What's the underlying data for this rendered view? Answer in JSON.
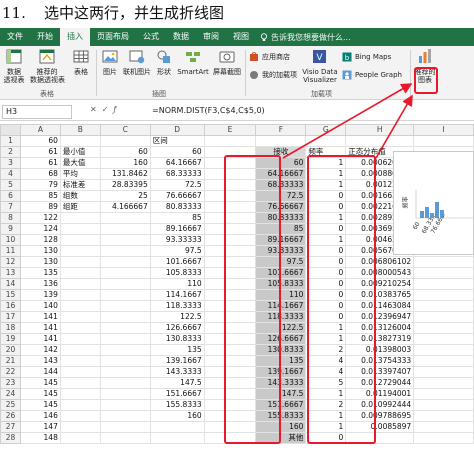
{
  "heading": {
    "num": "11.",
    "text": "选中这两行，并生成折线图"
  },
  "ribbon": {
    "tabs": [
      "文件",
      "开始",
      "插入",
      "页面布局",
      "公式",
      "数据",
      "审阅",
      "视图"
    ],
    "active_tab": "插入",
    "tell_me": "告诉我您想要做什么...",
    "buttons": {
      "pivot": "数据\n透视表",
      "rec_pivot": "推荐的\n数据透视表",
      "table": "表格",
      "picture": "图片",
      "online_pic": "联机图片",
      "shapes": "形状",
      "smartart": "SmartArt",
      "screenshot": "屏幕截图",
      "store": "应用商店",
      "my_addins": "我的加载项",
      "visio": "Visio Data\nVisualizer",
      "bing": "Bing Maps",
      "people": "People Graph",
      "rec_charts": "推荐的\n图表"
    },
    "groups": {
      "tables": "表格",
      "illustrations": "插图",
      "addins": "加载项"
    }
  },
  "formula_bar": {
    "name_box": "H3",
    "formula": "=NORM.DIST(F3,C$4,C$5,0)"
  },
  "grid": {
    "columns": [
      "A",
      "B",
      "C",
      "D",
      "E",
      "F",
      "G",
      "H",
      "I"
    ],
    "rows": [
      {
        "n": "1",
        "A": "60",
        "B": "",
        "C": "",
        "D": "区间",
        "E": "",
        "F": "",
        "G": "",
        "H": ""
      },
      {
        "n": "2",
        "A": "61",
        "B": "最小值",
        "C": "60",
        "D": "60",
        "E": "",
        "F": "接收",
        "G": "频率",
        "H": "正态分布值"
      },
      {
        "n": "3",
        "A": "61",
        "B": "最大值",
        "C": "160",
        "D": "64.16667",
        "E": "",
        "F": "60",
        "G": "1",
        "H": "0.000620597"
      },
      {
        "n": "4",
        "A": "68",
        "B": "平均",
        "C": "131.8462",
        "D": "68.33333",
        "E": "",
        "F": "64.16667",
        "G": "1",
        "H": "0.000880341"
      },
      {
        "n": "5",
        "A": "79",
        "B": "标准差",
        "C": "28.83395",
        "D": "72.5",
        "E": "",
        "F": "68.33333",
        "G": "1",
        "H": "0.00122299"
      },
      {
        "n": "6",
        "A": "85",
        "B": "组数",
        "C": "25",
        "D": "76.66667",
        "E": "",
        "F": "72.5",
        "G": "0",
        "H": "0.001663895"
      },
      {
        "n": "7",
        "A": "89",
        "B": "组距",
        "C": "4.166667",
        "D": "80.83333",
        "E": "",
        "F": "76.66667",
        "G": "0",
        "H": "0.002216972"
      },
      {
        "n": "8",
        "A": "122",
        "B": "",
        "C": "",
        "D": "85",
        "E": "",
        "F": "80.83333",
        "G": "1",
        "H": "0.002892848"
      },
      {
        "n": "9",
        "A": "124",
        "B": "",
        "C": "",
        "D": "89.16667",
        "E": "",
        "F": "85",
        "G": "0",
        "H": "0.003695566"
      },
      {
        "n": "10",
        "A": "128",
        "B": "",
        "C": "",
        "D": "93.33333",
        "E": "",
        "F": "89.16667",
        "G": "1",
        "H": "0.00462647"
      },
      {
        "n": "11",
        "A": "130",
        "B": "",
        "C": "",
        "D": "97.5",
        "E": "",
        "F": "93.33333",
        "G": "0",
        "H": "0.005670333"
      },
      {
        "n": "12",
        "A": "130",
        "B": "",
        "C": "",
        "D": "101.6667",
        "E": "",
        "F": "97.5",
        "G": "0",
        "H": "0.006806102"
      },
      {
        "n": "13",
        "A": "135",
        "B": "",
        "C": "",
        "D": "105.8333",
        "E": "",
        "F": "101.6667",
        "G": "0",
        "H": "0.008000543"
      },
      {
        "n": "14",
        "A": "136",
        "B": "",
        "C": "",
        "D": "110",
        "E": "",
        "F": "105.8333",
        "G": "0",
        "H": "0.009210254"
      },
      {
        "n": "15",
        "A": "139",
        "B": "",
        "C": "",
        "D": "114.1667",
        "E": "",
        "F": "110",
        "G": "0",
        "H": "0.010383765"
      },
      {
        "n": "16",
        "A": "140",
        "B": "",
        "C": "",
        "D": "118.3333",
        "E": "",
        "F": "114.1667",
        "G": "0",
        "H": "0.011463084"
      },
      {
        "n": "17",
        "A": "141",
        "B": "",
        "C": "",
        "D": "122.5",
        "E": "",
        "F": "118.3333",
        "G": "0",
        "H": "0.012396947"
      },
      {
        "n": "18",
        "A": "141",
        "B": "",
        "C": "",
        "D": "126.6667",
        "E": "",
        "F": "122.5",
        "G": "1",
        "H": "0.013126004"
      },
      {
        "n": "19",
        "A": "141",
        "B": "",
        "C": "",
        "D": "130.8333",
        "E": "",
        "F": "126.6667",
        "G": "1",
        "H": "0.013827319"
      },
      {
        "n": "20",
        "A": "142",
        "B": "",
        "C": "",
        "D": "135",
        "E": "",
        "F": "130.8333",
        "G": "2",
        "H": "0.01398003"
      },
      {
        "n": "21",
        "A": "143",
        "B": "",
        "C": "",
        "D": "139.1667",
        "E": "",
        "F": "135",
        "G": "4",
        "H": "0.013754333"
      },
      {
        "n": "22",
        "A": "144",
        "B": "",
        "C": "",
        "D": "143.3333",
        "E": "",
        "F": "139.1667",
        "G": "4",
        "H": "0.013397407"
      },
      {
        "n": "23",
        "A": "145",
        "B": "",
        "C": "",
        "D": "147.5",
        "E": "",
        "F": "143.3333",
        "G": "5",
        "H": "0.012729044"
      },
      {
        "n": "24",
        "A": "145",
        "B": "",
        "C": "",
        "D": "151.6667",
        "E": "",
        "F": "147.5",
        "G": "1",
        "H": "0.01194001"
      },
      {
        "n": "25",
        "A": "145",
        "B": "",
        "C": "",
        "D": "155.8333",
        "E": "",
        "F": "151.6667",
        "G": "2",
        "H": "0.010992444"
      },
      {
        "n": "26",
        "A": "146",
        "B": "",
        "C": "",
        "D": "160",
        "E": "",
        "F": "155.8333",
        "G": "1",
        "H": "0.009788695"
      },
      {
        "n": "27",
        "A": "147",
        "B": "",
        "C": "",
        "D": "",
        "E": "",
        "F": "160",
        "G": "1",
        "H": "0.0085897"
      },
      {
        "n": "28",
        "A": "148",
        "B": "",
        "C": "",
        "D": "",
        "E": "",
        "F": "其他",
        "G": "0",
        "H": ""
      }
    ]
  },
  "chart_thumb": {
    "ylabel": "频率"
  },
  "colors": {
    "excel_green": "#217346",
    "highlight_red": "#e8192c",
    "selection_gray": "#c9c9c9",
    "bar_blue": "#5b9bd5"
  }
}
